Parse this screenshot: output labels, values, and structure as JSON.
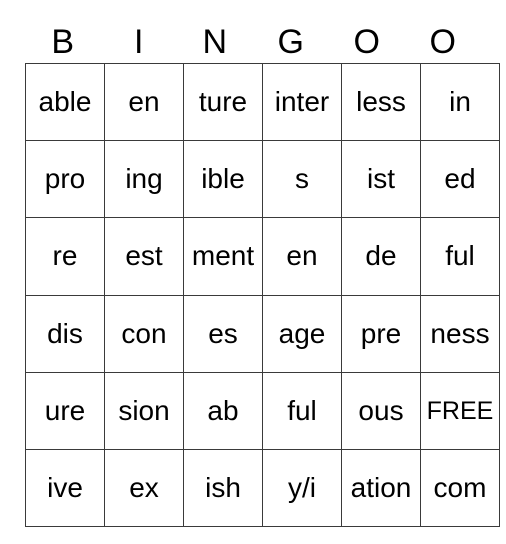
{
  "card": {
    "header_letters": [
      "B",
      "I",
      "N",
      "G",
      "O",
      "O"
    ],
    "free_space_label": "FREE",
    "rows": [
      [
        "able",
        "en",
        "ture",
        "inter",
        "less",
        "in"
      ],
      [
        "pro",
        "ing",
        "ible",
        "s",
        "ist",
        "ed"
      ],
      [
        "re",
        "est",
        "ment",
        "en",
        "de",
        "ful"
      ],
      [
        "dis",
        "con",
        "es",
        "age",
        "pre",
        "ness"
      ],
      [
        "ure",
        "sion",
        "ab",
        "ful",
        "ous",
        "FREE"
      ],
      [
        "ive",
        "ex",
        "ish",
        "y/i",
        "ation",
        "com"
      ]
    ],
    "colors": {
      "background": "#ffffff",
      "border": "#3a3a3a",
      "text": "#000000"
    }
  }
}
